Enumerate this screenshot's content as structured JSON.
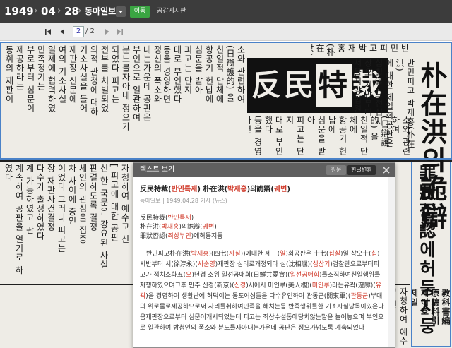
{
  "header": {
    "year": "1949",
    "month": "04",
    "day": "28",
    "newspaper": "동아일보",
    "go_label": "이동",
    "board_label": "공감게시판"
  },
  "pager": {
    "current_page": "2",
    "total_pages": "/ 2"
  },
  "scan": {
    "banner_word1": "反民",
    "banner_word2": "特",
    "banner_word3": "裁",
    "headline": "朴在洪의詭辯",
    "subheadline": "罪狀否認에허둥지둥",
    "col_left_upper": "정신의 폭소와\n내는가운데 공판은\n부인으로 일관하여\n분노를자아내 정오가\n되었다 피고는 \n전부를 처벌되었\n의적 관청에 대하\n기소사실을 들어\n재판장 신문에\n여의 기소사실\n일제에 협력하였\n민족정기는\n부로부터 심문이\n제공하라는\n동휘의 재판이\n울 산평양\n법정 유흥을\n민족을 배신하\n",
    "col_mid_upper": "소와 관련하여\n(日辯護的) 을\n친일적 단체에\n항공기 헌납에\n심문을 받아\n피고는 단지\n대로 부인했다\n등을 경영하면\n시판을 하였다",
    "col_right_upper": "반민피고 박재홍(朴在洪)\n에 대한 제일회공판은\n십칠일 오전십시\n상오 시반부터\n서울지방법원\n관 재판장\n심문으로 개정\n(沈相璣)검찰관\n으로부터 피고",
    "col_left_lower": "자청하여 예수교 신\n[ 피고에 대한 공판\n신 한 국문은 강요된 사실\n판결하도록 결정\n세인의 관심을 집중\n차 사이에 증인\n이었다 그러나 피고는\n장 재판사건결정\n다수가 출정하였다\n계 가능하였고 판\n계속하여 공판을 열기로 하였다",
    "col_right_lower": "教科書編\n原稿料引\n제이호\n제일\n소련군\n시정부"
  },
  "panel": {
    "title": "텍스트 보기",
    "btn_original": "원문",
    "btn_convert": "한글변환",
    "art_title_p1": "反民特裁(",
    "art_title_kw1": "반민특재",
    "art_title_p2": ") 朴在洪(",
    "art_title_kw2": "박재홍",
    "art_title_p3": ")의詭辯(",
    "art_title_kw3": "궤변",
    "art_title_p4": ")",
    "meta": "동아일보 | 1949.04.28 기사 (뉴스)",
    "head1_p1": "反民特裁(",
    "head1_kw": "반민특재",
    "head1_p2": ")",
    "head2_p1": "朴在洪(",
    "head2_kw1": "박재홍",
    "head2_p2": ")의詭辯(",
    "head2_kw2": "궤변",
    "head2_p3": ")",
    "head3_p1": "罪狀否認(",
    "head3_kw": "죄상부인",
    "head3_p2": ")에허둥지둥",
    "body_p1": "반민피고朴在洪(",
    "body_kw1": "박재홍",
    "body_p2": ")(四七(",
    "body_kw2": "사칠",
    "body_p3": "))에대한 제一(",
    "body_kw3": "일",
    "body_p4": ")회공판은 十七(",
    "body_kw4": "십칠",
    "body_p5": ")일 상오十(",
    "body_kw5": "십",
    "body_p6": ")시반부터 서(徐淳永)(",
    "body_kw6": "서순영",
    "body_p7": ")재판장 심리로개정되다 심(沈相璣)(",
    "body_kw7": "심상기",
    "body_p8": ")검찰관으로부터피고가 적치소화五(",
    "body_kw8": "오",
    "body_p9": ")년경 소위 일선공애회(日鮮共愛會)(",
    "body_kw9": "일선공애회",
    "body_p10": ")를조직하여친일행위를 자행하였으며그후 만주 신경(新京)(",
    "body_kw10": "신경",
    "body_p11": ")시에서 미인루(美人樓)(",
    "body_kw11": "미인루",
    "body_p12": ")라는유곽(遊廓)(",
    "body_kw12": "유곽",
    "body_p13": ")을 경영하여 생활난에 허덕이는 동포여성들을 다수유인하여 관동군(關東軍)(",
    "body_kw13": "관동군",
    "body_p14": ")부대의 위로물로제공하므로써 사리를취하여민족을 해치는등 반족행위를한 기소사실낭독이있은다음재판장으로부터 심문이개시되었는데 피고는 죄상수설동에당치않는말을 늘어놓으며 부인으로 일관하여 방청인의 폭소와 분노를자아내는가운데 공판은 정오가넘도록 계속되었다"
  }
}
